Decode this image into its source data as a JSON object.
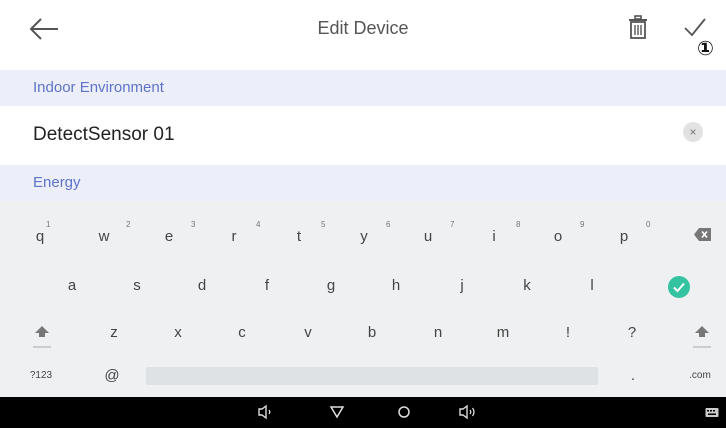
{
  "header": {
    "title": "Edit Device",
    "back_icon": "arrow-left-icon",
    "delete_icon": "trash-icon",
    "confirm_icon": "check-icon",
    "annotation_badge": "①"
  },
  "sections": {
    "indoor_label": "Indoor Environment",
    "energy_label": "Energy"
  },
  "device": {
    "name_value": "DetectSensor 01",
    "clear_icon": "×"
  },
  "keyboard": {
    "row1": [
      {
        "key": "q",
        "hint": "1"
      },
      {
        "key": "w",
        "hint": "2"
      },
      {
        "key": "e",
        "hint": "3"
      },
      {
        "key": "r",
        "hint": "4"
      },
      {
        "key": "t",
        "hint": "5"
      },
      {
        "key": "y",
        "hint": "6"
      },
      {
        "key": "u",
        "hint": "7"
      },
      {
        "key": "i",
        "hint": "8"
      },
      {
        "key": "o",
        "hint": "9"
      },
      {
        "key": "p",
        "hint": "0"
      }
    ],
    "row2": [
      "a",
      "s",
      "d",
      "f",
      "g",
      "h",
      "j",
      "k",
      "l"
    ],
    "row3": [
      "z",
      "x",
      "c",
      "v",
      "b",
      "n",
      "m",
      "!",
      "?"
    ],
    "symbols_key": "?123",
    "at_key": "@",
    "period_key": ".",
    "dotcom_key": ".com",
    "backspace_icon": "backspace-icon",
    "enter_icon": "checkmark-circle-icon",
    "shift_icon": "shift-icon",
    "enter_color": "#34c3a0"
  },
  "navbar": {
    "icons": [
      "volume-down-icon",
      "back-triangle-icon",
      "home-circle-icon",
      "volume-up-icon",
      "keyboard-icon"
    ]
  }
}
